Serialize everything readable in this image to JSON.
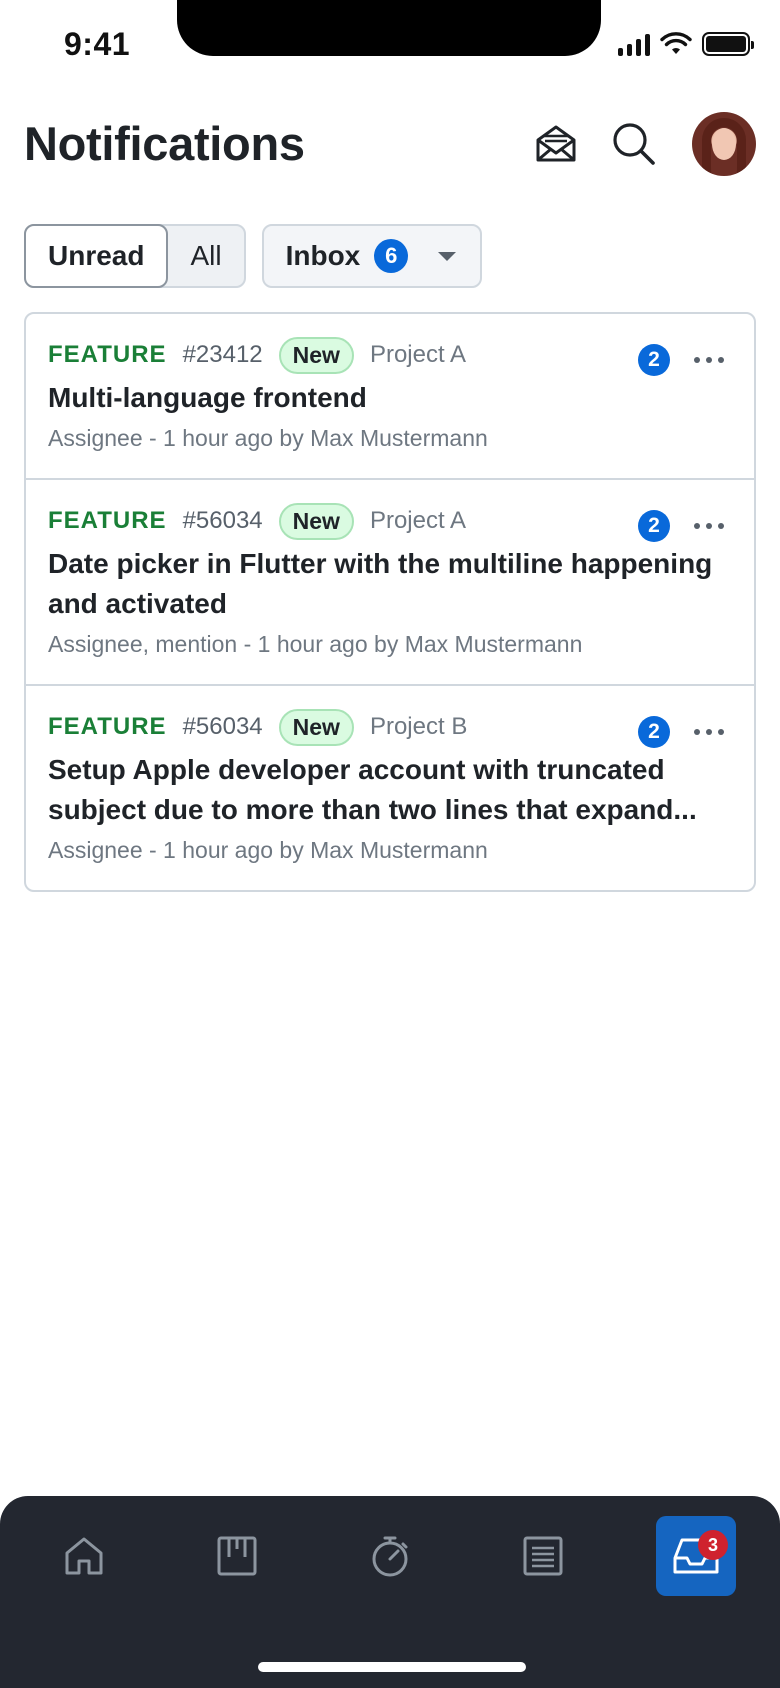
{
  "status_bar": {
    "time": "9:41"
  },
  "header": {
    "title": "Notifications",
    "icons": [
      "envelope-open-icon",
      "search-icon"
    ]
  },
  "filters": {
    "segments": [
      {
        "label": "Unread",
        "selected": true
      },
      {
        "label": "All",
        "selected": false
      }
    ],
    "inbox": {
      "label": "Inbox",
      "count": "6"
    }
  },
  "notifications": [
    {
      "type": "FEATURE",
      "id": "#23412",
      "state": "New",
      "project": "Project A",
      "count": "2",
      "title": "Multi-language frontend",
      "subtitle": "Assignee - 1 hour ago by Max Mustermann"
    },
    {
      "type": "FEATURE",
      "id": "#56034",
      "state": "New",
      "project": "Project A",
      "count": "2",
      "title": "Date picker in Flutter with the multiline happening and activated",
      "subtitle": "Assignee, mention - 1 hour ago by Max Mustermann"
    },
    {
      "type": "FEATURE",
      "id": "#56034",
      "state": "New",
      "project": "Project B",
      "count": "2",
      "title": "Setup Apple developer account with truncated subject due to more than two lines that expand...",
      "subtitle": "Assignee - 1 hour ago by Max Mustermann"
    }
  ],
  "tab_bar": {
    "tabs": [
      {
        "icon": "home-icon",
        "active": false
      },
      {
        "icon": "board-icon",
        "active": false
      },
      {
        "icon": "timer-icon",
        "active": false
      },
      {
        "icon": "list-icon",
        "active": false
      },
      {
        "icon": "inbox-icon",
        "active": true,
        "badge": "3"
      }
    ]
  },
  "colors": {
    "accent": "#0969da",
    "feature": "#1a7f37",
    "tab_bar": "#232730",
    "badge_red": "#cf222e"
  }
}
